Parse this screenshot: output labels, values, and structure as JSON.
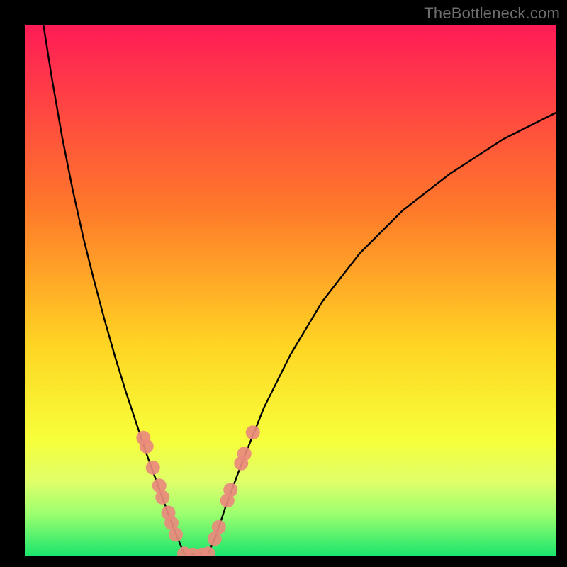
{
  "watermark": "TheBottleneck.com",
  "chart_data": {
    "type": "line",
    "title": "",
    "xlabel": "",
    "ylabel": "",
    "xlim": [
      0,
      100
    ],
    "ylim": [
      0,
      100
    ],
    "gradient_bands": [
      {
        "stop": 0.0,
        "color": "#ff1b56"
      },
      {
        "stop": 0.35,
        "color": "#ff7a2a"
      },
      {
        "stop": 0.6,
        "color": "#ffd423"
      },
      {
        "stop": 0.78,
        "color": "#f7ff3a"
      },
      {
        "stop": 0.86,
        "color": "#dfff6a"
      },
      {
        "stop": 0.92,
        "color": "#9cff6f"
      },
      {
        "stop": 1.0,
        "color": "#19e56c"
      }
    ],
    "series": [
      {
        "name": "left-curve",
        "x": [
          3.5,
          5,
          7,
          9,
          11,
          13,
          15,
          17,
          19,
          21,
          23,
          25,
          27,
          28.5,
          30
        ],
        "y": [
          100,
          90.5,
          79,
          69,
          60,
          52,
          44.5,
          37.5,
          31,
          25,
          19,
          13.5,
          8,
          4,
          0.5
        ]
      },
      {
        "name": "right-curve",
        "x": [
          34.5,
          36,
          38,
          41,
          45,
          50,
          56,
          63,
          71,
          80,
          90,
          100
        ],
        "y": [
          0.5,
          4,
          10,
          18,
          28,
          38,
          48,
          57,
          65,
          72,
          78.5,
          83.5
        ]
      },
      {
        "name": "floor-segment",
        "x": [
          30,
          34.5
        ],
        "y": [
          0.5,
          0.5
        ]
      }
    ],
    "marker_clusters": [
      {
        "name": "left-cluster",
        "color": "#e98a7d",
        "points": [
          {
            "x": 22.3,
            "y": 22.3
          },
          {
            "x": 22.9,
            "y": 20.7
          },
          {
            "x": 24.1,
            "y": 16.7
          },
          {
            "x": 25.3,
            "y": 13.3
          },
          {
            "x": 25.9,
            "y": 11.1
          },
          {
            "x": 27.0,
            "y": 8.2
          },
          {
            "x": 27.6,
            "y": 6.3
          },
          {
            "x": 28.4,
            "y": 4.1
          }
        ]
      },
      {
        "name": "bottom-cluster",
        "color": "#e98a7d",
        "points": [
          {
            "x": 30.0,
            "y": 0.5
          },
          {
            "x": 31.6,
            "y": 0.3
          },
          {
            "x": 33.3,
            "y": 0.3
          },
          {
            "x": 34.5,
            "y": 0.5
          }
        ]
      },
      {
        "name": "right-cluster",
        "color": "#e98a7d",
        "points": [
          {
            "x": 35.7,
            "y": 3.3
          },
          {
            "x": 36.5,
            "y": 5.5
          },
          {
            "x": 38.1,
            "y": 10.5
          },
          {
            "x": 38.7,
            "y": 12.5
          },
          {
            "x": 40.7,
            "y": 17.5
          },
          {
            "x": 41.3,
            "y": 19.3
          },
          {
            "x": 42.9,
            "y": 23.3
          }
        ]
      }
    ]
  }
}
